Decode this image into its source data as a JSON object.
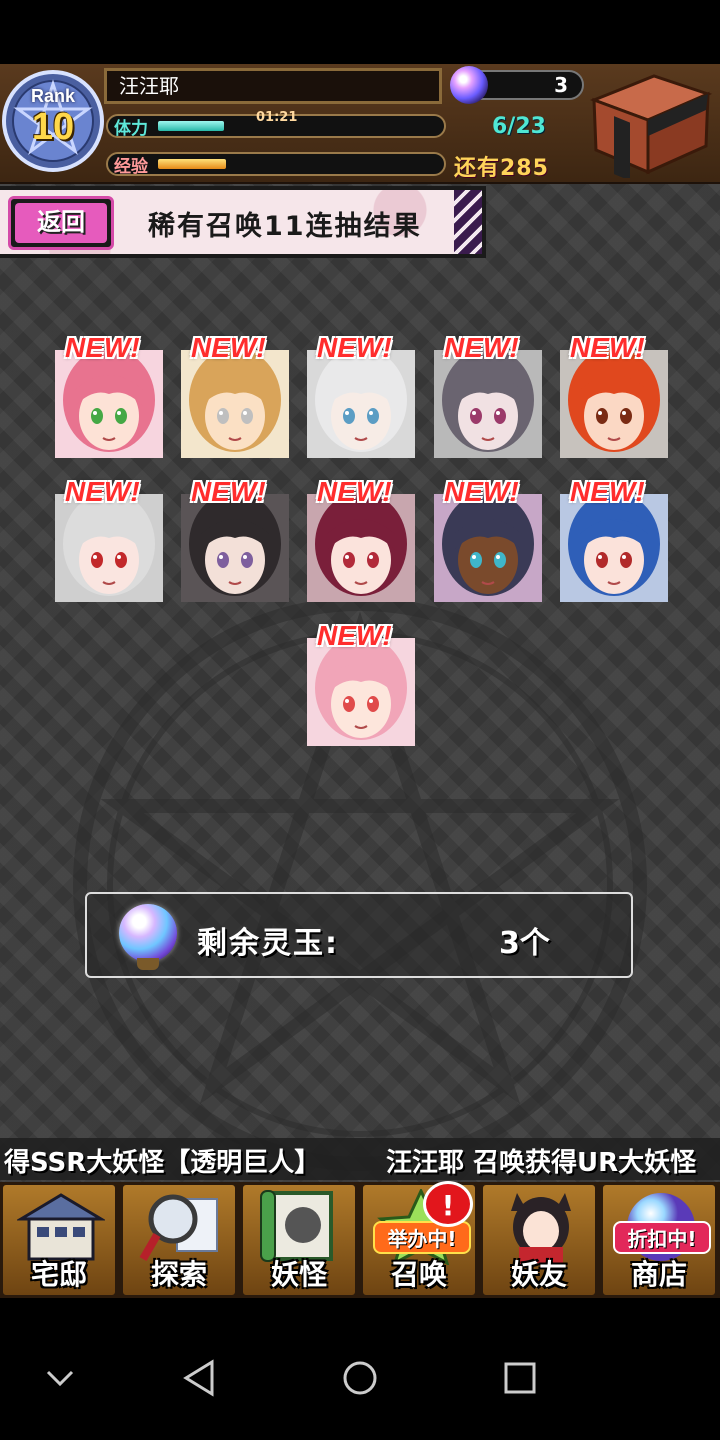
{
  "header": {
    "rank_label": "Rank",
    "rank_value": "10",
    "player_name": "汪汪耶",
    "stamina_label": "体力",
    "stamina_timer": "01:21",
    "stamina_fill_fraction": 0.26,
    "stamina_count": "6/23",
    "exp_label": "经验",
    "exp_fill_fraction": 0.27,
    "gem_count": "3",
    "remaining_label": "还有285"
  },
  "banner": {
    "back_label": "返回",
    "title": "稀有召唤11连抽结果"
  },
  "results": {
    "new_label": "NEW!",
    "cards": [
      {
        "hair": "#e8738f",
        "skin": "#fde2d6",
        "eyes": "#45a845",
        "bg": "#f7d5df"
      },
      {
        "hair": "#d9a45a",
        "skin": "#fbe0c4",
        "eyes": "#bfbfbf",
        "bg": "#f3e6cc"
      },
      {
        "hair": "#e9e9ea",
        "skin": "#f7ece6",
        "eyes": "#5b9dc4",
        "bg": "#d9d9d9"
      },
      {
        "hair": "#6a6470",
        "skin": "#f1e1e3",
        "eyes": "#9b3a6a",
        "bg": "#b9b9b9"
      },
      {
        "hair": "#e0481e",
        "skin": "#fbd8c4",
        "eyes": "#7a2b14",
        "bg": "#c7c2bd"
      },
      {
        "hair": "#dcdcdc",
        "skin": "#fae5e0",
        "eyes": "#c2282a",
        "bg": "#cfcfcf"
      },
      {
        "hair": "#2f2a2c",
        "skin": "#f3e0d8",
        "eyes": "#7e5f9e",
        "bg": "#5a5456"
      },
      {
        "hair": "#7a1f3a",
        "skin": "#fbe3dc",
        "eyes": "#b22a3a",
        "bg": "#c8a6ae"
      },
      {
        "hair": "#3a3a56",
        "skin": "#7a4a2c",
        "eyes": "#3fb6c9",
        "bg": "#c7a7c7"
      },
      {
        "hair": "#2f5fb8",
        "skin": "#fbe2da",
        "eyes": "#b22a2a",
        "bg": "#b9c8e3"
      },
      {
        "hair": "#f1a5b8",
        "skin": "#fde6dc",
        "eyes": "#e04b4b",
        "bg": "#f6d6df"
      }
    ]
  },
  "orb": {
    "label": "剩余灵玉:",
    "count": "3个"
  },
  "ticker": {
    "text_left": "得SSR大妖怪【透明巨人】",
    "text_right": "汪汪耶 召唤获得UR大妖怪"
  },
  "bottom_nav": {
    "items": [
      {
        "label": "宅邸",
        "icon": "house-icon"
      },
      {
        "label": "探索",
        "icon": "magnifier-map-icon"
      },
      {
        "label": "妖怪",
        "icon": "scroll-icon"
      },
      {
        "label": "召唤",
        "icon": "summon-star-icon",
        "tag": "举办中!",
        "alert": "!"
      },
      {
        "label": "妖友",
        "icon": "friend-girl-icon"
      },
      {
        "label": "商店",
        "icon": "shop-orb-icon",
        "tag": "折扣中!"
      }
    ]
  },
  "colors": {
    "banner_pink": "#e65bbd",
    "stamina_teal": "#4fe7d4",
    "gold": "#ffd45a",
    "new_red": "#ff2d2d"
  }
}
